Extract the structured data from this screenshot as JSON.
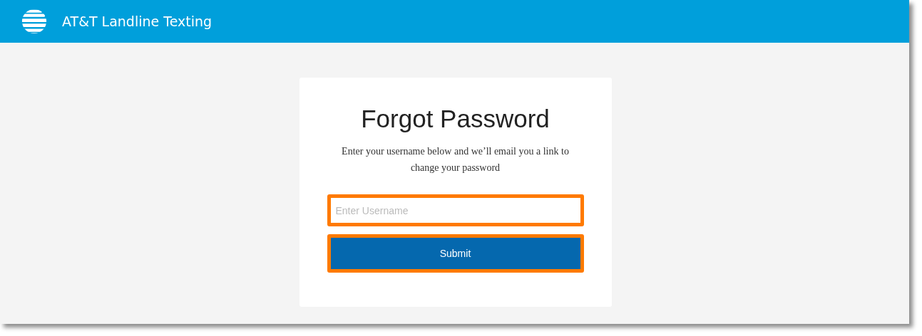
{
  "header": {
    "title": "AT&T Landline Texting"
  },
  "form": {
    "heading": "Forgot Password",
    "description": "Enter your username below and we’ll email you a link to change your password",
    "username_field": {
      "placeholder": "Enter Username",
      "highlighted": true
    },
    "submit_button": {
      "label": "Submit",
      "highlighted": true
    }
  }
}
